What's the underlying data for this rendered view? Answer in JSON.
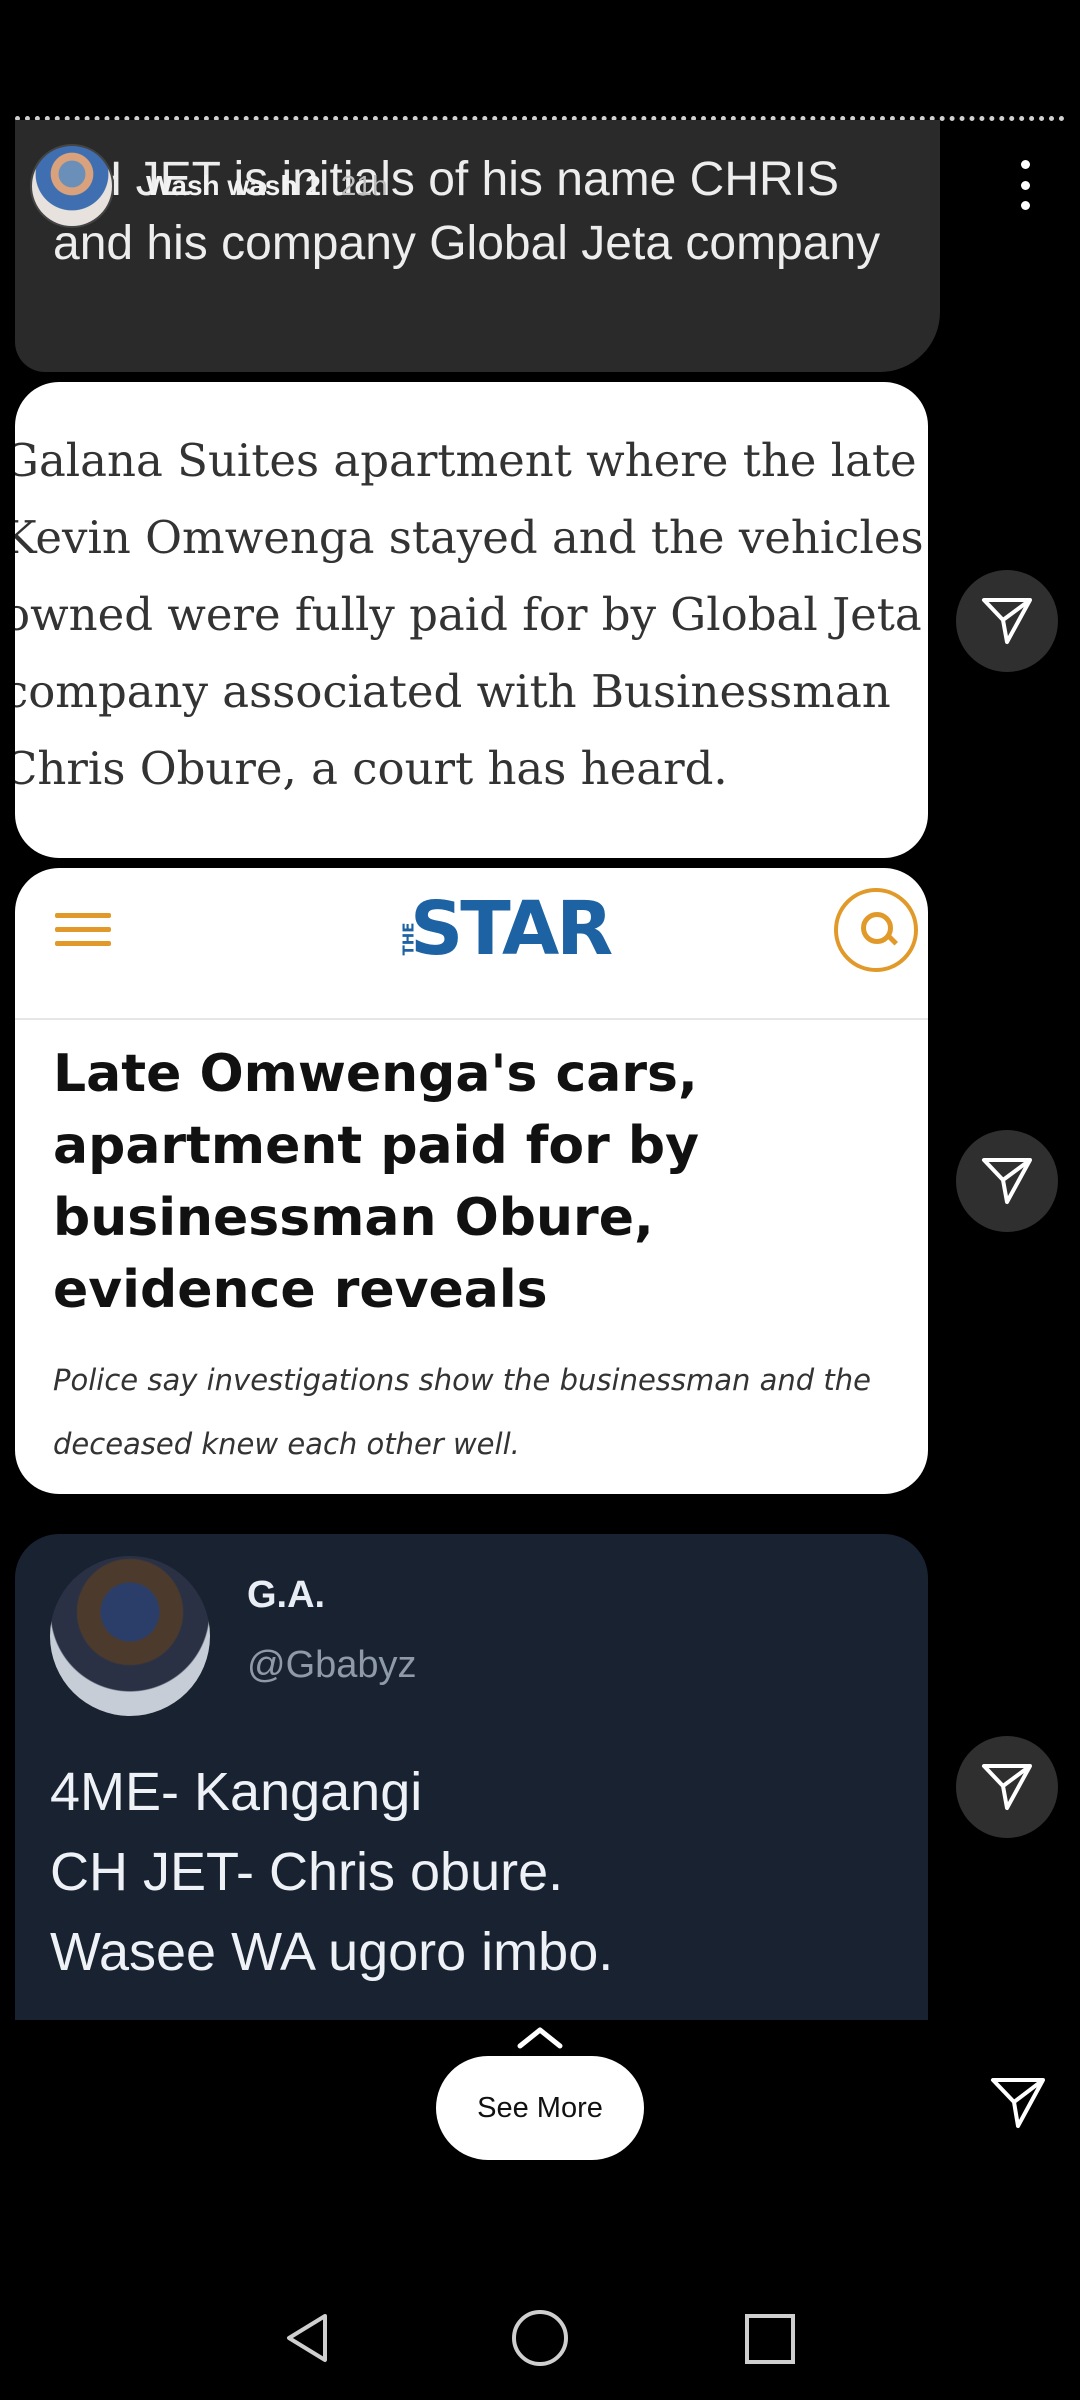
{
  "story": {
    "username": "Wash wash 2",
    "time": "21h"
  },
  "text_card": {
    "text": "CH JET is initials of his name CHRIS and his company Global Jeta company"
  },
  "quote_card": {
    "text": "Galana Suites apartment where the late\nKevin Omwenga stayed and the vehicles he\nowned were fully paid for by Global Jeta\ncompany associated with Businessman\nChris Obure, a court has heard."
  },
  "article_card": {
    "logo": "STAR",
    "logo_small": "THE",
    "headline": "Late Omwenga's cars, apartment paid for by businessman Obure, evidence reveals",
    "subhead": "Police say investigations show the businessman and the deceased knew each other well."
  },
  "tweet_card": {
    "name": "G.A.",
    "handle": "@Gbabyz",
    "body": "4ME- Kangangi\nCH JET- Chris obure.\nWasee WA ugoro imbo."
  },
  "footer": {
    "see_more_label": "See More"
  },
  "icons": {
    "share": "paper-plane-icon",
    "more": "more-vertical-icon",
    "nav_back": "triangle-back-icon",
    "nav_home": "circle-home-icon",
    "nav_recent": "square-recents-icon"
  }
}
